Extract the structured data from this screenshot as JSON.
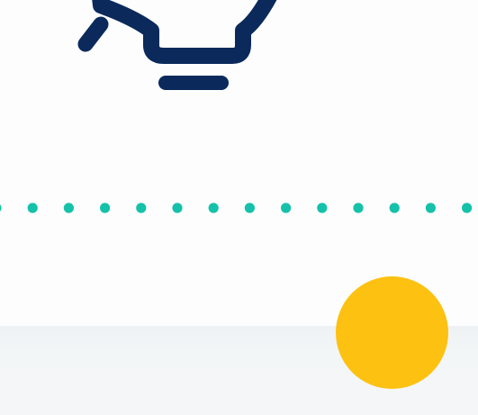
{
  "colors": {
    "background": "#fdfdfd",
    "band": "#eef2f4",
    "icon_navy": "#0b2a5b",
    "dot_teal": "#16c1aa",
    "accent_yellow": "#fdc112"
  },
  "icons": {
    "bulb": "lightbulb-icon",
    "divider": "dotted-divider",
    "accent": "yellow-circle"
  }
}
